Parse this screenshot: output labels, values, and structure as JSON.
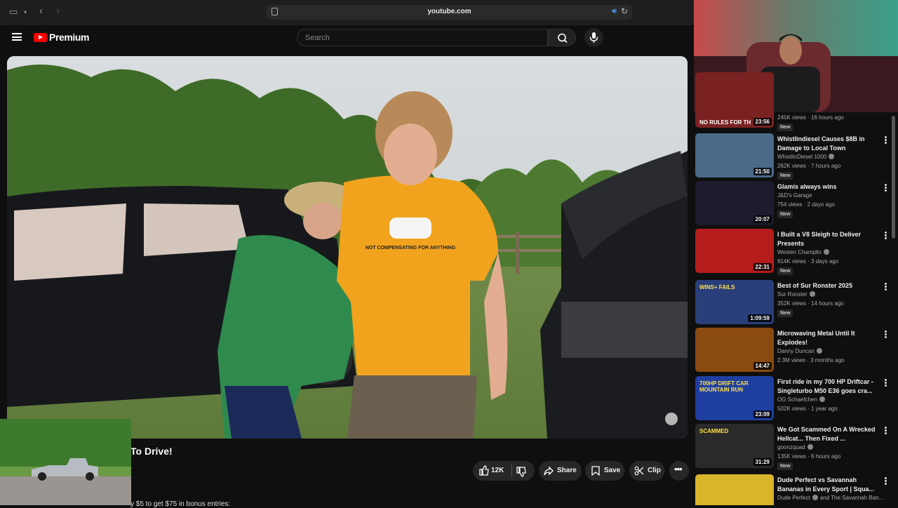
{
  "browser": {
    "url": "youtube.com"
  },
  "header": {
    "logo_label": "Premium",
    "search_placeholder": "Search"
  },
  "video": {
    "title_visible": "To Drive!",
    "description_snippet": "y $5 to get $75 in bonus entries:",
    "shirt_text": "NOT COMPENSATING FOR ANYTHING"
  },
  "actions": {
    "likes": "12K",
    "share": "Share",
    "save": "Save",
    "clip": "Clip"
  },
  "recommendations": [
    {
      "title": "",
      "channel": "",
      "meta": "245K views · 16 hours ago",
      "badge": "New",
      "duration": "23:56",
      "thumb_text": "NO RULES FOR TH",
      "color": "#7a2222"
    },
    {
      "title": "Whistlindiesel Causes $8B in Damage to Local Town",
      "channel": "WhistlinDiesel 1000",
      "meta": "262K views · 7 hours ago",
      "badge": "New",
      "duration": "21:50",
      "color": "#4a6a8a"
    },
    {
      "title": "Glamis always wins",
      "channel": "J&D's Garage",
      "meta": "754 views · 2 days ago",
      "badge": "New",
      "duration": "20:07",
      "color": "#1e1b2e"
    },
    {
      "title": "I Built a V8 Sleigh to Deliver Presents",
      "channel": "Westen Champlin",
      "meta": "914K views · 3 days ago",
      "badge": "New",
      "duration": "22:31",
      "color": "#b51c1c"
    },
    {
      "title": "Best of Sur Ronster 2025",
      "channel": "Sur Ronster",
      "meta": "352K views · 14 hours ago",
      "badge": "New",
      "duration": "1:09:59",
      "thumb_text": "WINS+ FAILS",
      "color": "#2a3f7a"
    },
    {
      "title": "Microwaving Metal Until It Explodes!",
      "channel": "Danny Duncan",
      "meta": "2.3M views · 3 months ago",
      "badge": "",
      "duration": "14:47",
      "color": "#8a4a10"
    },
    {
      "title": "First ride in my 700 HP Driftcar - Singleturbo M50 E36 goes cra...",
      "channel": "OG Schaefchen",
      "meta": "502K views · 1 year ago",
      "badge": "",
      "duration": "23:09",
      "thumb_text": "700HP DRIFT CAR MOUNTAIN RUN",
      "color": "#1f3fa0"
    },
    {
      "title": "We Got Scammed On A Wrecked Hellcat... Then Fixed ...",
      "channel": "goonzquad",
      "meta": "135K views · 6 hours ago",
      "badge": "New",
      "duration": "31:29",
      "thumb_text": "SCAMMED",
      "color": "#2a2a2a"
    },
    {
      "title": "Dude Perfect vs Savannah Bananas in Every Sport | Squa...",
      "channel": "Dude Perfect",
      "channel_extra": "and The Savannah Ban...",
      "meta": "",
      "badge": "",
      "duration": "",
      "color": "#d9b52a"
    }
  ]
}
